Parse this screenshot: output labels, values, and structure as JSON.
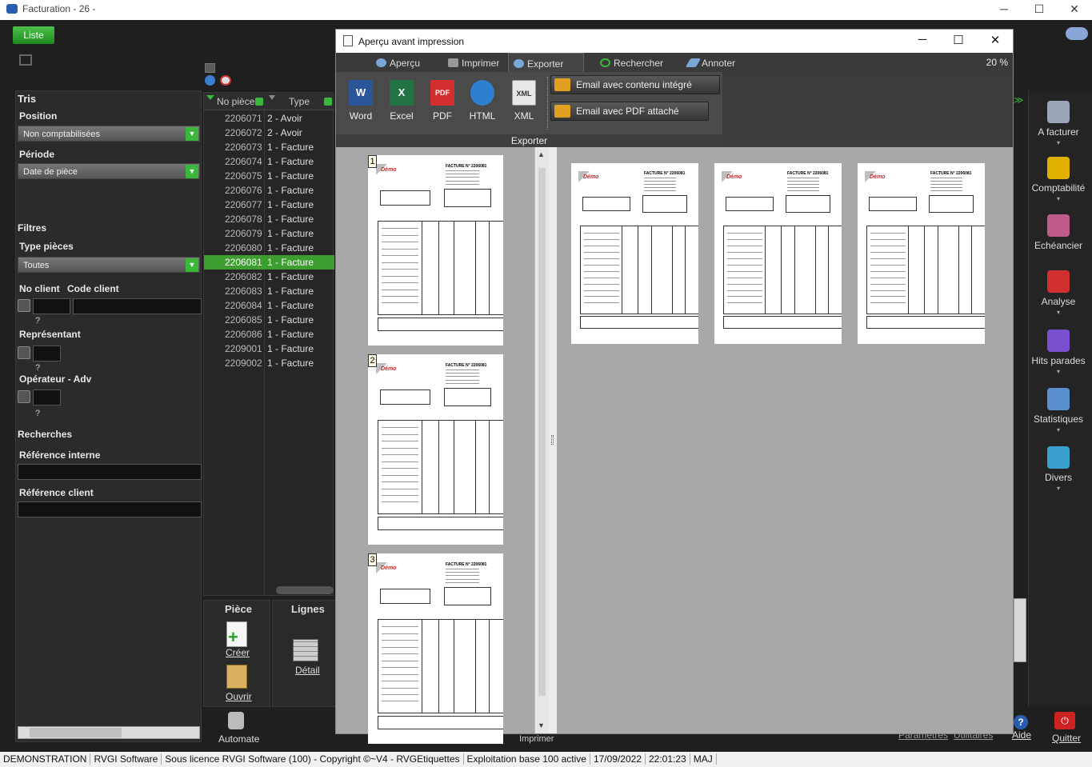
{
  "window": {
    "title": "Facturation - 26 -",
    "min": "─",
    "max": "☐",
    "close": "✕"
  },
  "toolbar": {
    "liste_label": "Liste"
  },
  "filters": {
    "tris_label": "Tris",
    "position_label": "Position",
    "position_value": "Non comptabilisées",
    "periode_label": "Période",
    "periode_value": "Date de pièce",
    "filtres_label": "Filtres",
    "type_pieces_label": "Type pièces",
    "type_pieces_value": "Toutes",
    "no_client_label": "No client",
    "code_client_label": "Code client",
    "representant_label": "Représentant",
    "operateur_label": "Opérateur - Adv",
    "question": "?",
    "recherches_label": "Recherches",
    "ref_interne_label": "Référence interne",
    "ref_client_label": "Référence client"
  },
  "list": {
    "headers": {
      "no_piece": "No pièce",
      "type": "Type"
    },
    "rows": [
      {
        "no": "2206071",
        "type": "2 - Avoir"
      },
      {
        "no": "2206072",
        "type": "2 - Avoir"
      },
      {
        "no": "2206073",
        "type": "1 - Facture"
      },
      {
        "no": "2206074",
        "type": "1 - Facture"
      },
      {
        "no": "2206075",
        "type": "1 - Facture"
      },
      {
        "no": "2206076",
        "type": "1 - Facture"
      },
      {
        "no": "2206077",
        "type": "1 - Facture"
      },
      {
        "no": "2206078",
        "type": "1 - Facture"
      },
      {
        "no": "2206079",
        "type": "1 - Facture"
      },
      {
        "no": "2206080",
        "type": "1 - Facture"
      },
      {
        "no": "2206081",
        "type": "1 - Facture"
      },
      {
        "no": "2206082",
        "type": "1 - Facture"
      },
      {
        "no": "2206083",
        "type": "1 - Facture"
      },
      {
        "no": "2206084",
        "type": "1 - Facture"
      },
      {
        "no": "2206085",
        "type": "1 - Facture"
      },
      {
        "no": "2206086",
        "type": "1 - Facture"
      },
      {
        "no": "2209001",
        "type": "1 - Facture"
      },
      {
        "no": "2209002",
        "type": "1 - Facture"
      }
    ],
    "selected_no": "2206081"
  },
  "piece_box": {
    "title": "Pièce",
    "creer": "Créer",
    "ouvrir": "Ouvrir"
  },
  "lignes_box": {
    "title": "Lignes",
    "detail": "Détail"
  },
  "bottom": {
    "automate": "Automate",
    "imprimer": "Imprimer",
    "parametres": "Paramètres",
    "utilitaires": "Utilitaires",
    "aide": "Aide",
    "quitter": "Quitter"
  },
  "right_bar": {
    "items": [
      {
        "label": "A facturer",
        "icon": "invoice-icon",
        "color": "#9aa6b8"
      },
      {
        "label": "Comptabilité",
        "icon": "euro-icon",
        "color": "#e0b000"
      },
      {
        "label": "Echéancier",
        "icon": "calendar-money-icon",
        "color": "#c05a8a"
      },
      {
        "label": "Analyse",
        "icon": "pie-chart-icon",
        "color": "#d03030"
      },
      {
        "label": "Hits parades",
        "icon": "bar-chart-icon",
        "color": "#7a4fd0"
      },
      {
        "label": "Statistiques",
        "icon": "line-chart-icon",
        "color": "#5a8fd0"
      },
      {
        "label": "Divers",
        "icon": "circles-icon",
        "color": "#3aa0d0"
      }
    ]
  },
  "status": [
    "DEMONSTRATION",
    "RVGI Software",
    "Sous licence RVGI Software (100) - Copyright ©~V4 - RVGEtiquettes",
    "Exploitation base 100 active",
    "17/09/2022",
    "22:01:23",
    "MAJ"
  ],
  "dialog": {
    "title": "Aperçu avant impression",
    "tabs": [
      "Aperçu",
      "Imprimer",
      "Exporter",
      "Rechercher",
      "Annoter"
    ],
    "active_tab": "Exporter",
    "zoom": "20 %",
    "export_buttons": [
      {
        "label": "Word",
        "icon": "word-icon",
        "badge": "W",
        "color": "#2b579a"
      },
      {
        "label": "Excel",
        "icon": "excel-icon",
        "badge": "X",
        "color": "#217346"
      },
      {
        "label": "PDF",
        "icon": "pdf-icon",
        "badge": "PDF",
        "color": "#d32f2f"
      },
      {
        "label": "HTML",
        "icon": "html-icon",
        "badge": "",
        "color": "#2f7fd0"
      },
      {
        "label": "XML",
        "icon": "xml-icon",
        "badge": "XML",
        "color": "#e8e8e8"
      }
    ],
    "email_integrated": "Email avec contenu intégré",
    "email_pdf": "Email avec PDF attaché",
    "group_label": "Exporter",
    "page_numbers": [
      "1",
      "2",
      "3"
    ],
    "invoice_title": "FACTURE N° 2206081",
    "logo_text": "Démo"
  }
}
